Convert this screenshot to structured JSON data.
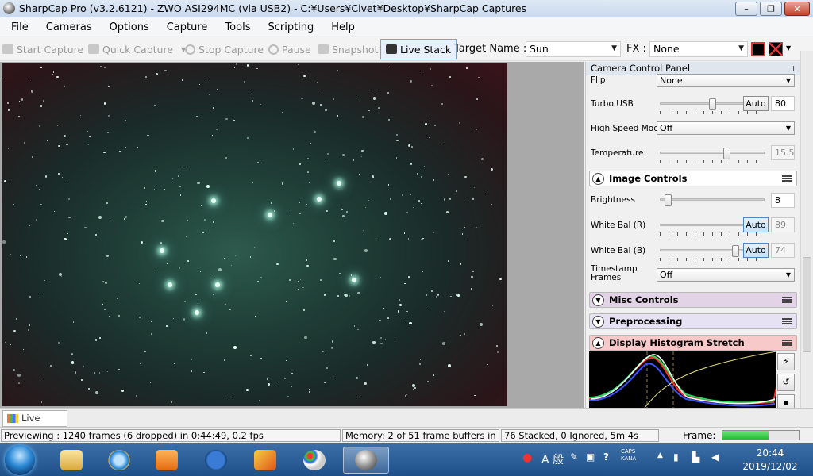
{
  "window": {
    "title": "SharpCap Pro (v3.2.6121) - ZWO ASI294MC (via USB2) - C:¥Users¥Civet¥Desktop¥SharpCap Captures",
    "minimize": "–",
    "maximize": "❐",
    "close": "✕"
  },
  "menu": [
    "File",
    "Cameras",
    "Options",
    "Capture",
    "Tools",
    "Scripting",
    "Help"
  ],
  "toolbar": {
    "start_capture": "Start Capture",
    "quick_capture": "Quick Capture",
    "stop_capture": "Stop Capture",
    "pause": "Pause",
    "snapshot": "Snapshot",
    "live_stack": "Live Stack",
    "target_label": "Target Name :",
    "target_value": "Sun",
    "fx_label": "FX :",
    "fx_value": "None"
  },
  "camera_panel": {
    "title": "Camera Control Panel",
    "flip": {
      "label": "Flip",
      "value": "None"
    },
    "turbo_usb": {
      "label": "Turbo USB",
      "auto": "Auto",
      "value": "80",
      "level": 0.5
    },
    "high_speed": {
      "label": "High Speed Mode",
      "value": "Off"
    },
    "temperature": {
      "label": "Temperature",
      "value": "15.5",
      "level": 0.65
    },
    "image_controls": {
      "title": "Image Controls",
      "brightness": {
        "label": "Brightness",
        "value": "8",
        "level": 0.05
      },
      "wb_r": {
        "label": "White Bal (R)",
        "auto": "Auto",
        "value": "89",
        "level": 0.9
      },
      "wb_b": {
        "label": "White Bal (B)",
        "auto": "Auto",
        "value": "74",
        "level": 0.74
      },
      "timestamp": {
        "label": "Timestamp Frames",
        "value": "Off"
      }
    },
    "misc_controls": "Misc Controls",
    "preprocessing": "Preprocessing",
    "histogram": "Display Histogram Stretch"
  },
  "tab": {
    "live_stack": "Live Stack"
  },
  "status": {
    "preview": "Previewing : 1240 frames (6 dropped) in 0:44:49, 0.2 fps",
    "memory": "Memory: 2 of 51 frame buffers in use",
    "stacked": "76 Stacked, 0 Ignored, 5m 4s",
    "frame_label": "Frame:",
    "frame_progress": 0.6
  },
  "taskbar": {
    "time": "20:44",
    "date": "2019/12/02",
    "ime": "A 般",
    "caps": "CAPS",
    "kana": "KANA"
  },
  "colors": {
    "histogram_grid": "#7a6a3a",
    "hist_red": "#ff2a2a",
    "hist_green": "#28d85a",
    "hist_blue": "#3a55ff",
    "hist_white": "#ffffff",
    "hist_curve": "#e8e080"
  }
}
